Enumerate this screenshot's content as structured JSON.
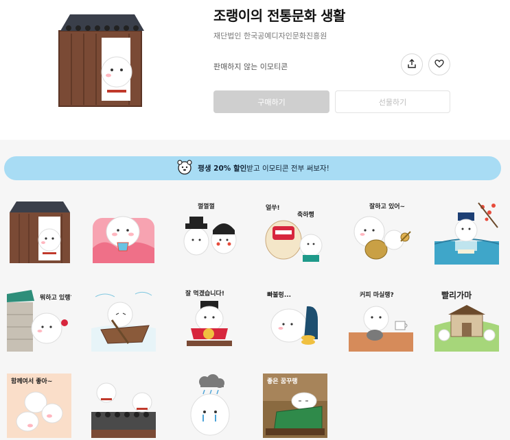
{
  "product": {
    "title": "조랭이의 전통문화 생활",
    "publisher": "재단법인 한국공예디자인문화진흥원",
    "status": "판매하지 않는 이모티콘"
  },
  "actions": {
    "buy_label": "구매하기",
    "gift_label": "선물하기",
    "share_icon": "share-icon",
    "like_icon": "heart-icon"
  },
  "banner": {
    "highlight": "평생 20% 할인",
    "rest": " 받고 이모티콘 전부 써보자!"
  },
  "stickers": [
    {
      "name": "hanok-door",
      "caption": ""
    },
    {
      "name": "hug-bokjumeoni",
      "caption": ""
    },
    {
      "name": "wedding",
      "caption": "껄껄껄"
    },
    {
      "name": "lion-dance",
      "caption_a": "얼쑤!",
      "caption_b": "축하행"
    },
    {
      "name": "drum",
      "caption": "잘하고 있어~"
    },
    {
      "name": "scholar-reading",
      "caption": ""
    },
    {
      "name": "peeking-wall",
      "caption": "뭐하고 있랭?"
    },
    {
      "name": "rowing-boat",
      "caption": ""
    },
    {
      "name": "eating-feast",
      "caption": "잘 먹겠습니다!"
    },
    {
      "name": "laundry",
      "caption": "빠불렁..."
    },
    {
      "name": "coffee",
      "caption": "커피 마실랭?"
    },
    {
      "name": "hurry-house",
      "caption": "빨리가마"
    },
    {
      "name": "together",
      "caption": "함께여서 좋아~"
    },
    {
      "name": "roof-run",
      "caption": ""
    },
    {
      "name": "rain-cloud",
      "caption": ""
    },
    {
      "name": "sleeping",
      "caption": "좋은 꿈꾸랭"
    }
  ],
  "colors": {
    "banner_bg": "#a8dcf4",
    "buy_disabled": "#cfcfcf",
    "gallery_bg": "#f6f6f6"
  }
}
